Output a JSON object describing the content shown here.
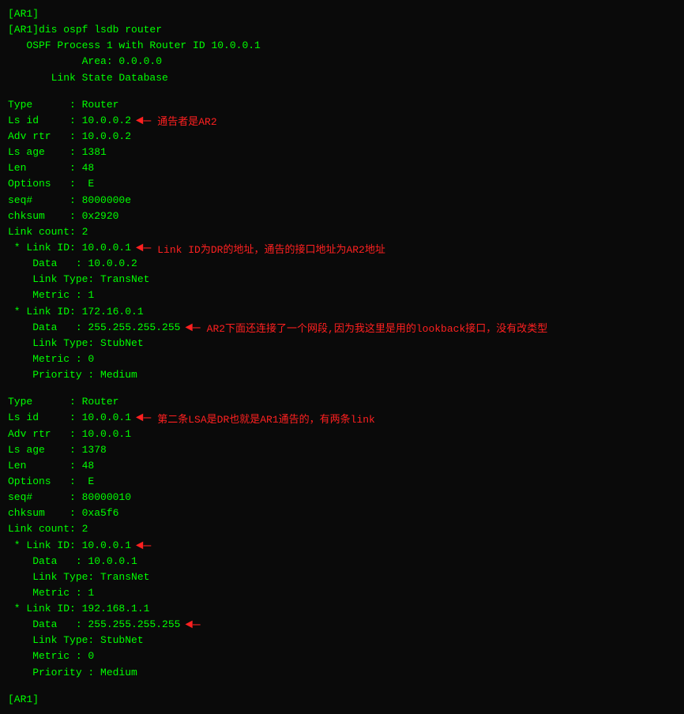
{
  "terminal": {
    "prompt1": "[AR1]",
    "command": "[AR1]dis ospf lsdb router",
    "header": {
      "line1": "   OSPF Process 1 with Router ID 10.0.0.1",
      "line2": "            Area: 0.0.0.0",
      "line3": "       Link State Database"
    },
    "lsa1": {
      "type": "Type      : Router",
      "ls_id": "Ls id     : 10.0.0.2",
      "adv_rtr": "Adv rtr   : 10.0.0.2",
      "ls_age": "Ls age    : 1381",
      "len": "Len       : 48",
      "options": "Options   :  E",
      "seq": "seq#      : 8000000e",
      "chksum": "chksum    : 0x2920",
      "link_count": "Link count: 2",
      "link1_id": " * Link ID: 10.0.0.1",
      "link1_data": "    Data   : 10.0.0.2",
      "link1_type": "    Link Type: TransNet",
      "link1_metric": "    Metric : 1",
      "link2_id": " * Link ID: 172.16.0.1",
      "link2_data": "    Data   : 255.255.255.255",
      "link2_type": "    Link Type: StubNet",
      "link2_metric": "    Metric : 0",
      "link2_priority": "    Priority : Medium"
    },
    "lsa2": {
      "type": "Type      : Router",
      "ls_id": "Ls id     : 10.0.0.1",
      "adv_rtr": "Adv rtr   : 10.0.0.1",
      "ls_age": "Ls age    : 1378",
      "len": "Len       : 48",
      "options": "Options   :  E",
      "seq": "seq#      : 80000010",
      "chksum": "chksum    : 0xa5f6",
      "link_count": "Link count: 2",
      "link1_id": " * Link ID: 10.0.0.1",
      "link1_data": "    Data   : 10.0.0.1",
      "link1_type": "    Link Type: TransNet",
      "link1_metric": "    Metric : 1",
      "link2_id": " * Link ID: 192.168.1.1",
      "link2_data": "    Data   : 255.255.255.255",
      "link2_type": "    Link Type: StubNet",
      "link2_metric": "    Metric : 0",
      "link2_priority": "    Priority : Medium"
    },
    "prompt2": "[AR1]"
  },
  "annotations": {
    "ann1": "通告者是AR2",
    "ann2": "Link ID为DR的地址，通告的接口地址为AR2地址",
    "ann3": "AR2下面还连接了一个网段,因为我这里是用的lookback接口，没有改类型",
    "ann4": "第二条LSA是DR也就是AR1通告的，有两条link"
  }
}
